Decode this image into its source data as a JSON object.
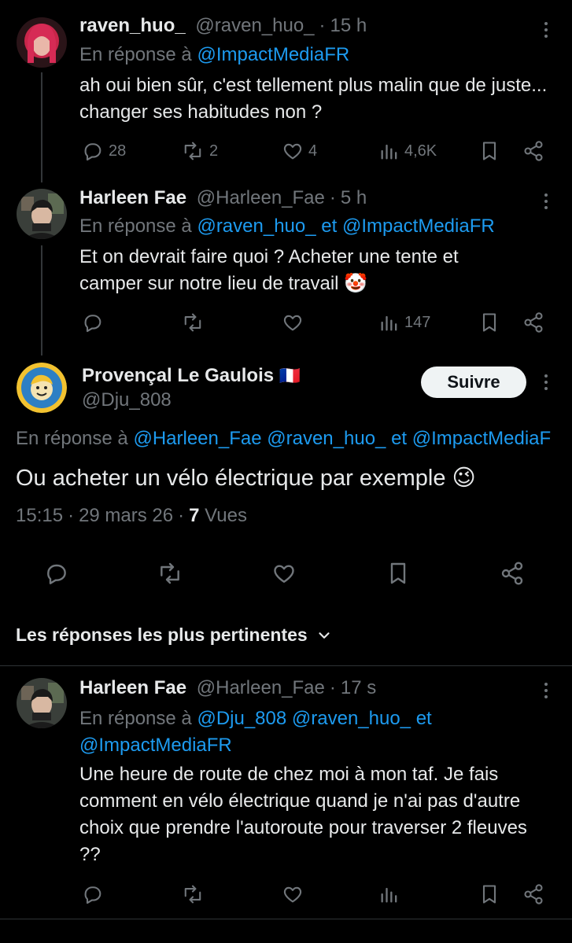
{
  "reply1": {
    "name": "raven_huo_",
    "handle": "@raven_huo_",
    "time": "15 h",
    "reply_prefix": "En réponse à",
    "reply_to": "@ImpactMediaFR",
    "text": "ah oui bien sûr, c'est tellement plus malin que de juste... changer ses habitudes non ?",
    "replies": "28",
    "reposts": "2",
    "likes": "4",
    "views": "4,6K"
  },
  "reply2": {
    "name": "Harleen Fae",
    "handle": "@Harleen_Fae",
    "time": "5 h",
    "reply_prefix": "En réponse à",
    "reply_to_1": "@raven_huo_",
    "conj": "et",
    "reply_to_2": "@ImpactMediaFR",
    "text": "Et on devrait faire quoi ? Acheter une tente et camper sur notre lieu de travail",
    "emoji": "🤡",
    "views": "147"
  },
  "main": {
    "name": "Provençal Le Gaulois",
    "flag": "🇫🇷",
    "handle": "@Dju_808",
    "follow_label": "Suivre",
    "reply_prefix": "En réponse à",
    "reply_to_1": "@Harleen_Fae",
    "reply_to_2": "@raven_huo_",
    "conj": "et",
    "reply_to_3": "@ImpactMediaF",
    "text": "Ou acheter un vélo électrique par exemple",
    "emoji": "😉",
    "time": "15:15",
    "date": "29 mars 26",
    "views_count": "7",
    "views_label": "Vues"
  },
  "sort": {
    "label": "Les réponses les plus pertinentes"
  },
  "reply3": {
    "name": "Harleen Fae",
    "handle": "@Harleen_Fae",
    "time": "17 s",
    "reply_prefix": "En réponse à",
    "reply_to_1": "@Dju_808",
    "reply_to_2": "@raven_huo_",
    "conj": "et",
    "reply_to_3": "@ImpactMediaFR",
    "text": "Une heure de route de chez moi à mon taf. Je fais comment en vélo électrique quand je n'ai pas d'autre choix que prendre l'autoroute pour traverser 2 fleuves ??"
  },
  "colors": {
    "background": "#000000",
    "text": "#e7e9ea",
    "secondary": "#71767b",
    "link": "#1d9bf0"
  }
}
